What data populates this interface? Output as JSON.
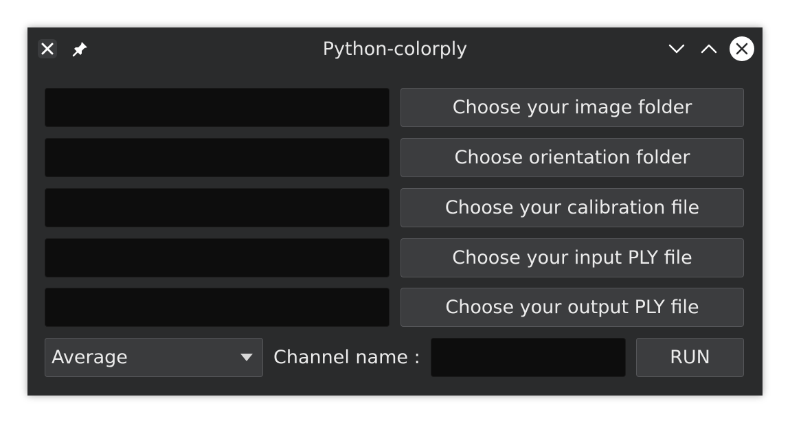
{
  "window": {
    "title": "Python-colorply"
  },
  "icons": {
    "app": "close-x-icon",
    "pin": "pin-icon",
    "minimize": "chevron-down-icon",
    "maximize": "chevron-up-icon",
    "close": "close-circle-icon"
  },
  "rows": [
    {
      "field_value": "",
      "button_label": "Choose your image folder"
    },
    {
      "field_value": "",
      "button_label": "Choose orientation folder"
    },
    {
      "field_value": "",
      "button_label": "Choose your calibration file"
    },
    {
      "field_value": "",
      "button_label": "Choose your input PLY file"
    },
    {
      "field_value": "",
      "button_label": "Choose your output PLY file"
    }
  ],
  "bottom": {
    "mode_selected": "Average",
    "channel_label": "Channel name :",
    "channel_value": "",
    "run_label": "RUN"
  },
  "colors": {
    "window_bg": "#2a2b2c",
    "field_bg": "#0d0d0d",
    "button_bg": "#3c3d3f",
    "text": "#ececec"
  }
}
